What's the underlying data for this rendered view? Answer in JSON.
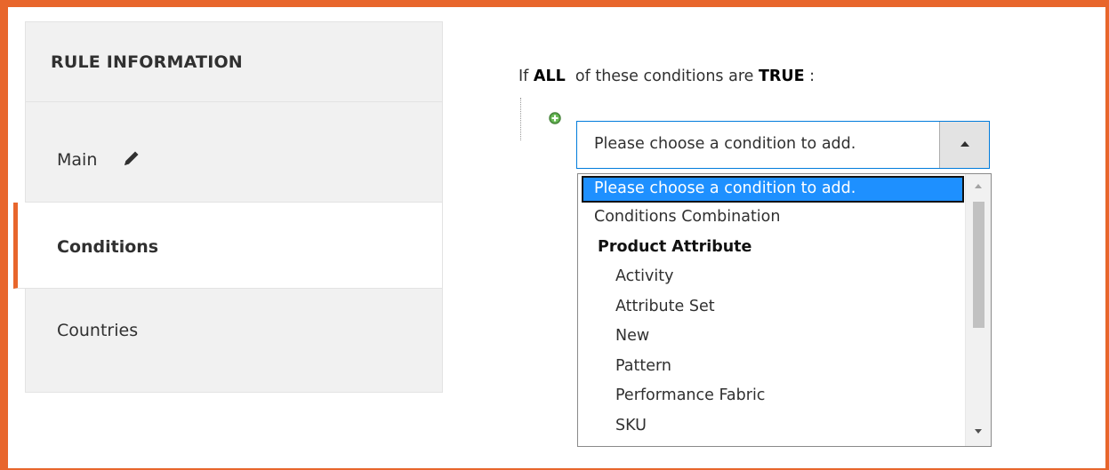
{
  "sidebar": {
    "title": "RULE INFORMATION",
    "items": [
      {
        "label": "Main"
      },
      {
        "label": "Conditions"
      },
      {
        "label": "Countries"
      }
    ]
  },
  "conditions": {
    "header_prefix": "If",
    "aggregator": "ALL",
    "header_middle": "of these conditions are",
    "value": "TRUE",
    "header_suffix": ":",
    "select_value": "Please choose a condition to add.",
    "options": [
      "Please choose a condition to add.",
      "Conditions Combination"
    ],
    "group_label": "Product Attribute",
    "group_options": [
      "Activity",
      "Attribute Set",
      "New",
      "Pattern",
      "Performance Fabric",
      "SKU"
    ]
  },
  "colors": {
    "accent": "#e8662c",
    "selected_option": "#1e90ff",
    "select_border": "#007bdb"
  },
  "icons": {
    "edit": "pencil-icon",
    "add": "add-condition-icon",
    "select_toggle": "triangle-up-icon"
  }
}
